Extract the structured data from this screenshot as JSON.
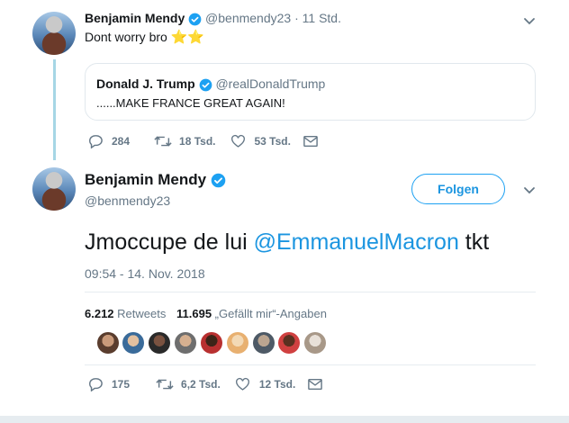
{
  "tweet1": {
    "name": "Benjamin Mendy",
    "handle": "@benmendy23",
    "time": "· 11 Std.",
    "text": "Dont worry bro",
    "emoji": "⭐⭐",
    "quoted": {
      "name": "Donald J. Trump",
      "handle": "@realDonaldTrump",
      "text": "......MAKE FRANCE GREAT AGAIN!"
    },
    "replies": "284",
    "retweets": "18 Tsd.",
    "likes": "53 Tsd."
  },
  "tweet2": {
    "name": "Benjamin Mendy",
    "handle": "@benmendy23",
    "follow_label": "Folgen",
    "text_before": "Jmoccupe de lui ",
    "mention": "@EmmanuelMacron",
    "text_after": " tkt",
    "timestamp": "09:54 - 14. Nov. 2018",
    "retweet_count": "6.212",
    "retweet_label": "Retweets",
    "like_count": "11.695",
    "like_label": "„Gefällt mir“-Angaben",
    "replies": "175",
    "retweets": "6,2 Tsd.",
    "likes": "12 Tsd."
  },
  "colors": {
    "accent": "#1da1f2",
    "link": "#1b95e0",
    "muted": "#657786",
    "thread_line": "#a6d6e5"
  },
  "likers": [
    "liker-1",
    "liker-2",
    "liker-3",
    "liker-4",
    "liker-5",
    "liker-6",
    "liker-7",
    "liker-8",
    "liker-9",
    "liker-10"
  ]
}
